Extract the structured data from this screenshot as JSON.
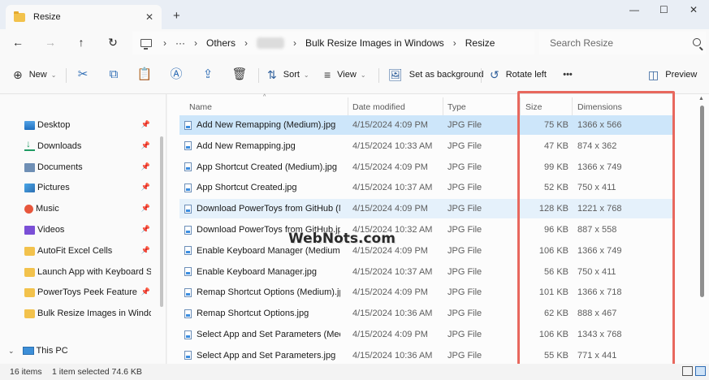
{
  "window": {
    "tab_title": "Resize",
    "close_tab_glyph": "✕",
    "new_tab_glyph": "+",
    "minimize_glyph": "—",
    "maximize_glyph": "☐",
    "close_glyph": "✕"
  },
  "address": {
    "back_glyph": "←",
    "forward_glyph": "→",
    "up_glyph": "↑",
    "refresh_glyph": "↻",
    "sep_glyph": "›",
    "more_glyph": "···",
    "crumbs": [
      "Others",
      "Bulk Resize Images in Windows",
      "Resize"
    ],
    "search_placeholder": "Search Resize"
  },
  "commands": {
    "new_label": "New",
    "sort_label": "Sort",
    "view_label": "View",
    "set_background_label": "Set as background",
    "rotate_left_label": "Rotate left",
    "more_glyph": "•••",
    "preview_label": "Preview",
    "chevron_glyph": "⌄",
    "plus_glyph": "⊕",
    "cut_glyph": "✂",
    "copy_glyph": "⧉",
    "paste_glyph": "📋",
    "rename_glyph": "Ⓐ",
    "share_glyph": "⇪",
    "delete_glyph": "🗑",
    "sort_glyph": "⇅",
    "view_glyph": "≡",
    "background_glyph": "🖼",
    "rotate_glyph": "↺",
    "preview_glyph": "◫"
  },
  "nav": {
    "pin_glyph": "📌",
    "items": [
      {
        "label": "Desktop",
        "icon": "desktop-icon"
      },
      {
        "label": "Downloads",
        "icon": "downloads-icon"
      },
      {
        "label": "Documents",
        "icon": "documents-icon"
      },
      {
        "label": "Pictures",
        "icon": "pictures-icon"
      },
      {
        "label": "Music",
        "icon": "music-icon"
      },
      {
        "label": "Videos",
        "icon": "videos-icon"
      },
      {
        "label": "AutoFit Excel Cells",
        "icon": "folder-icon"
      },
      {
        "label": "Launch App with Keyboard Shortcut",
        "icon": "folder-icon"
      },
      {
        "label": "PowerToys Peek Feature",
        "icon": "folder-icon"
      },
      {
        "label": "Bulk Resize Images in Windows",
        "icon": "folder-icon"
      }
    ],
    "this_pc_label": "This PC",
    "this_pc_chevron": "⌄"
  },
  "columns": {
    "name": "Name",
    "date": "Date modified",
    "type": "Type",
    "size": "Size",
    "dimensions": "Dimensions",
    "sort_caret": "^"
  },
  "files": [
    {
      "name": "Add New Remapping (Medium).jpg",
      "date": "4/15/2024 4:09 PM",
      "type": "JPG File",
      "size": "75 KB",
      "dimensions": "1366 x 566",
      "state": "selected"
    },
    {
      "name": "Add New Remapping.jpg",
      "date": "4/15/2024 10:33 AM",
      "type": "JPG File",
      "size": "47 KB",
      "dimensions": "874 x 362",
      "state": ""
    },
    {
      "name": "App Shortcut Created (Medium).jpg",
      "date": "4/15/2024 4:09 PM",
      "type": "JPG File",
      "size": "99 KB",
      "dimensions": "1366 x 749",
      "state": ""
    },
    {
      "name": "App Shortcut Created.jpg",
      "date": "4/15/2024 10:37 AM",
      "type": "JPG File",
      "size": "52 KB",
      "dimensions": "750 x 411",
      "state": ""
    },
    {
      "name": "Download PowerToys from GitHub (Medium).jpg",
      "date": "4/15/2024 4:09 PM",
      "type": "JPG File",
      "size": "128 KB",
      "dimensions": "1221 x 768",
      "state": "hover"
    },
    {
      "name": "Download PowerToys from GitHub.jpg",
      "date": "4/15/2024 10:32 AM",
      "type": "JPG File",
      "size": "96 KB",
      "dimensions": "887 x 558",
      "state": ""
    },
    {
      "name": "Enable Keyboard Manager (Medium).jpg",
      "date": "4/15/2024 4:09 PM",
      "type": "JPG File",
      "size": "106 KB",
      "dimensions": "1366 x 749",
      "state": ""
    },
    {
      "name": "Enable Keyboard Manager.jpg",
      "date": "4/15/2024 10:37 AM",
      "type": "JPG File",
      "size": "56 KB",
      "dimensions": "750 x 411",
      "state": ""
    },
    {
      "name": "Remap Shortcut Options (Medium).jpg",
      "date": "4/15/2024 4:09 PM",
      "type": "JPG File",
      "size": "101 KB",
      "dimensions": "1366 x 718",
      "state": ""
    },
    {
      "name": "Remap Shortcut Options.jpg",
      "date": "4/15/2024 10:36 AM",
      "type": "JPG File",
      "size": "62 KB",
      "dimensions": "888 x 467",
      "state": ""
    },
    {
      "name": "Select App and Set Parameters (Medium).jpg",
      "date": "4/15/2024 4:09 PM",
      "type": "JPG File",
      "size": "106 KB",
      "dimensions": "1343 x 768",
      "state": ""
    },
    {
      "name": "Select App and Set Parameters.jpg",
      "date": "4/15/2024 10:36 AM",
      "type": "JPG File",
      "size": "55 KB",
      "dimensions": "771 x 441",
      "state": ""
    }
  ],
  "status": {
    "item_count": "16 items",
    "selection": "1 item selected  74.6 KB"
  },
  "watermark": "WebNots.com",
  "colors": {
    "accent": "#2f6db5",
    "selected_row": "#cde6fa",
    "highlight_box": "#e8685e"
  }
}
